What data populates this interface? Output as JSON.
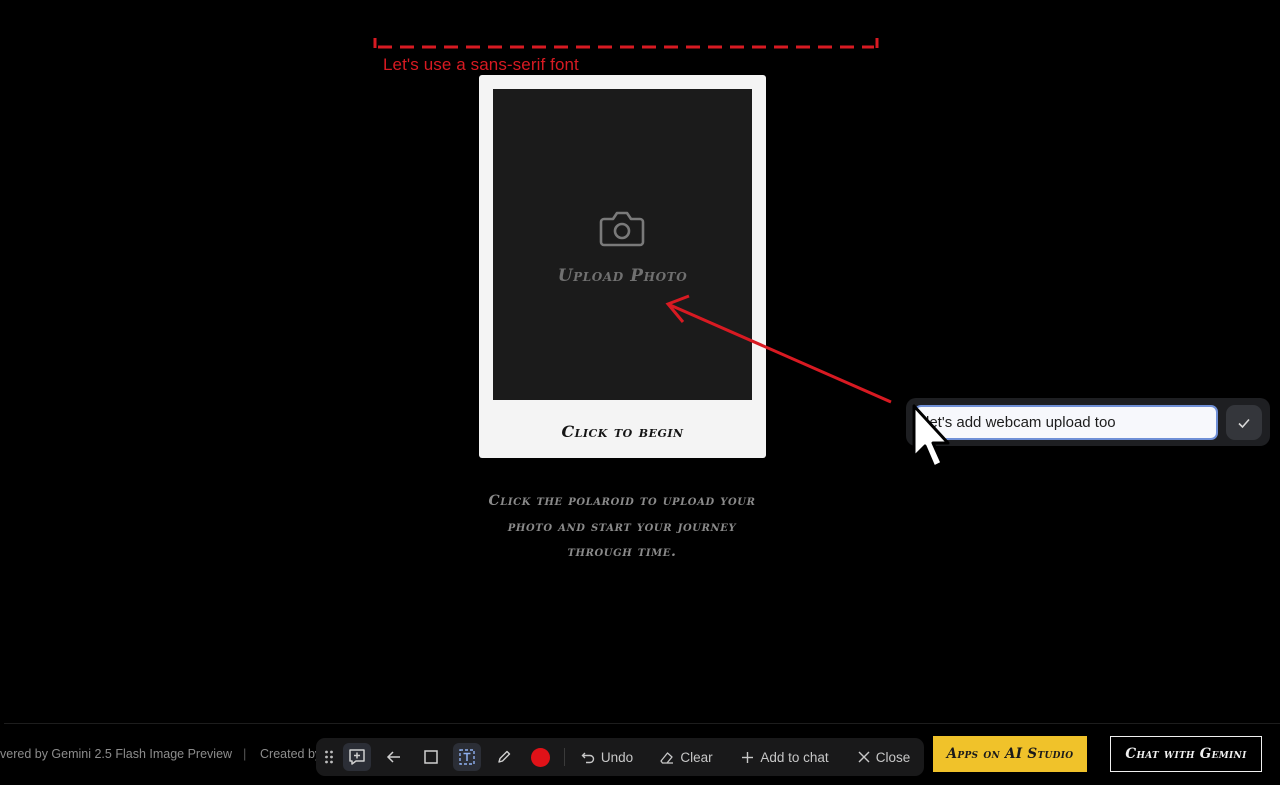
{
  "annotation": {
    "label": "Let's use a sans-serif font",
    "color": "#d81a22"
  },
  "polaroid": {
    "upload_label": "Upload Photo",
    "caption": "Click to begin",
    "icon": "camera-icon"
  },
  "instructions": {
    "lines": [
      "Click the polaroid to upload your",
      "photo and start your journey",
      "through time."
    ]
  },
  "comment": {
    "value": "let's add webcam upload too",
    "submit_icon": "check-icon"
  },
  "footer": {
    "powered_by": "vered by Gemini 2.5 Flash Image Preview",
    "separator": "|",
    "created_by": "Created by"
  },
  "toolbar": {
    "undo_label": "Undo",
    "clear_label": "Clear",
    "add_to_chat_label": "Add to chat",
    "close_label": "Close",
    "draw_color": "#e01218"
  },
  "buttons": {
    "apps_label": "Apps on AI Studio",
    "chat_label": "Chat with Gemini",
    "apps_color": "#f0c22a"
  }
}
